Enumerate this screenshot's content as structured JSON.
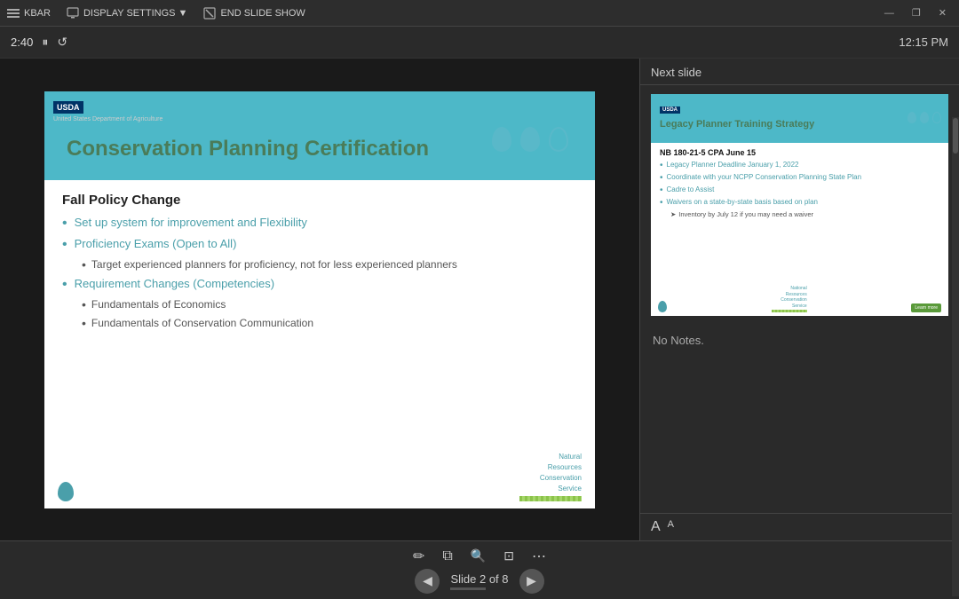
{
  "topbar": {
    "items": [
      {
        "label": "KBAR",
        "icon": "menu-icon"
      },
      {
        "label": "DISPLAY SETTINGS ▼",
        "icon": "display-icon"
      },
      {
        "label": "END SLIDE SHOW",
        "icon": "end-icon"
      }
    ],
    "win_minimize": "—",
    "win_restore": "❐",
    "win_close": "✕"
  },
  "playerbar": {
    "time_elapsed": "2:40",
    "pause_icon": "⏸",
    "refresh_icon": "↺",
    "clock_time": "12:15 PM"
  },
  "slide": {
    "usda_label": "USDA",
    "usda_subtext": "United States Department of Agriculture",
    "title": "Conservation Planning Certification",
    "section_title": "Fall Policy Change",
    "bullets": [
      {
        "text": "Set up system for improvement and Flexibility",
        "sub_bullets": []
      },
      {
        "text": "Proficiency Exams (Open to All)",
        "sub_bullets": [
          "Target experienced planners for proficiency, not for less experienced planners"
        ]
      },
      {
        "text": "Requirement Changes (Competencies)",
        "sub_bullets": [
          "Fundamentals of Economics",
          "Fundamentals of Conservation Communication"
        ]
      }
    ],
    "nrcs_branding": "Natural\nResources\nConservation\nService",
    "slide_drop_color": "#4a9faa"
  },
  "right_panel": {
    "next_slide_label": "Next slide",
    "thumb": {
      "usda_label": "USDA",
      "title": "Legacy Planner Training Strategy",
      "subtitle": "NB 180-21-5 CPA June 15",
      "bullets": [
        {
          "text": "Legacy Planner Deadline January 1, 2022",
          "sub": []
        },
        {
          "text": "Coordinate with your NCPP Conservation Planning State Plan",
          "sub": []
        },
        {
          "text": "Cadre to Assist",
          "sub": []
        },
        {
          "text": "Waivers on a state-by-state basis based on plan",
          "sub": [
            "Inventory by July 12 if you may need a waiver"
          ]
        }
      ],
      "nrcs_label": "National\nResources\nConservation\nService",
      "green_btn": "Learn more"
    },
    "notes_label": "No Notes.",
    "font_size_increase": "A",
    "font_size_decrease": "A"
  },
  "bottombar": {
    "icons": [
      {
        "name": "pencil-icon",
        "symbol": "✏"
      },
      {
        "name": "copy-icon",
        "symbol": "⧉"
      },
      {
        "name": "search-icon",
        "symbol": "🔍"
      },
      {
        "name": "crop-icon",
        "symbol": "⊡"
      },
      {
        "name": "more-icon",
        "symbol": "⋯"
      }
    ],
    "prev_label": "◀",
    "slide_indicator": "Slide 2 of 8",
    "next_label": "▶"
  }
}
